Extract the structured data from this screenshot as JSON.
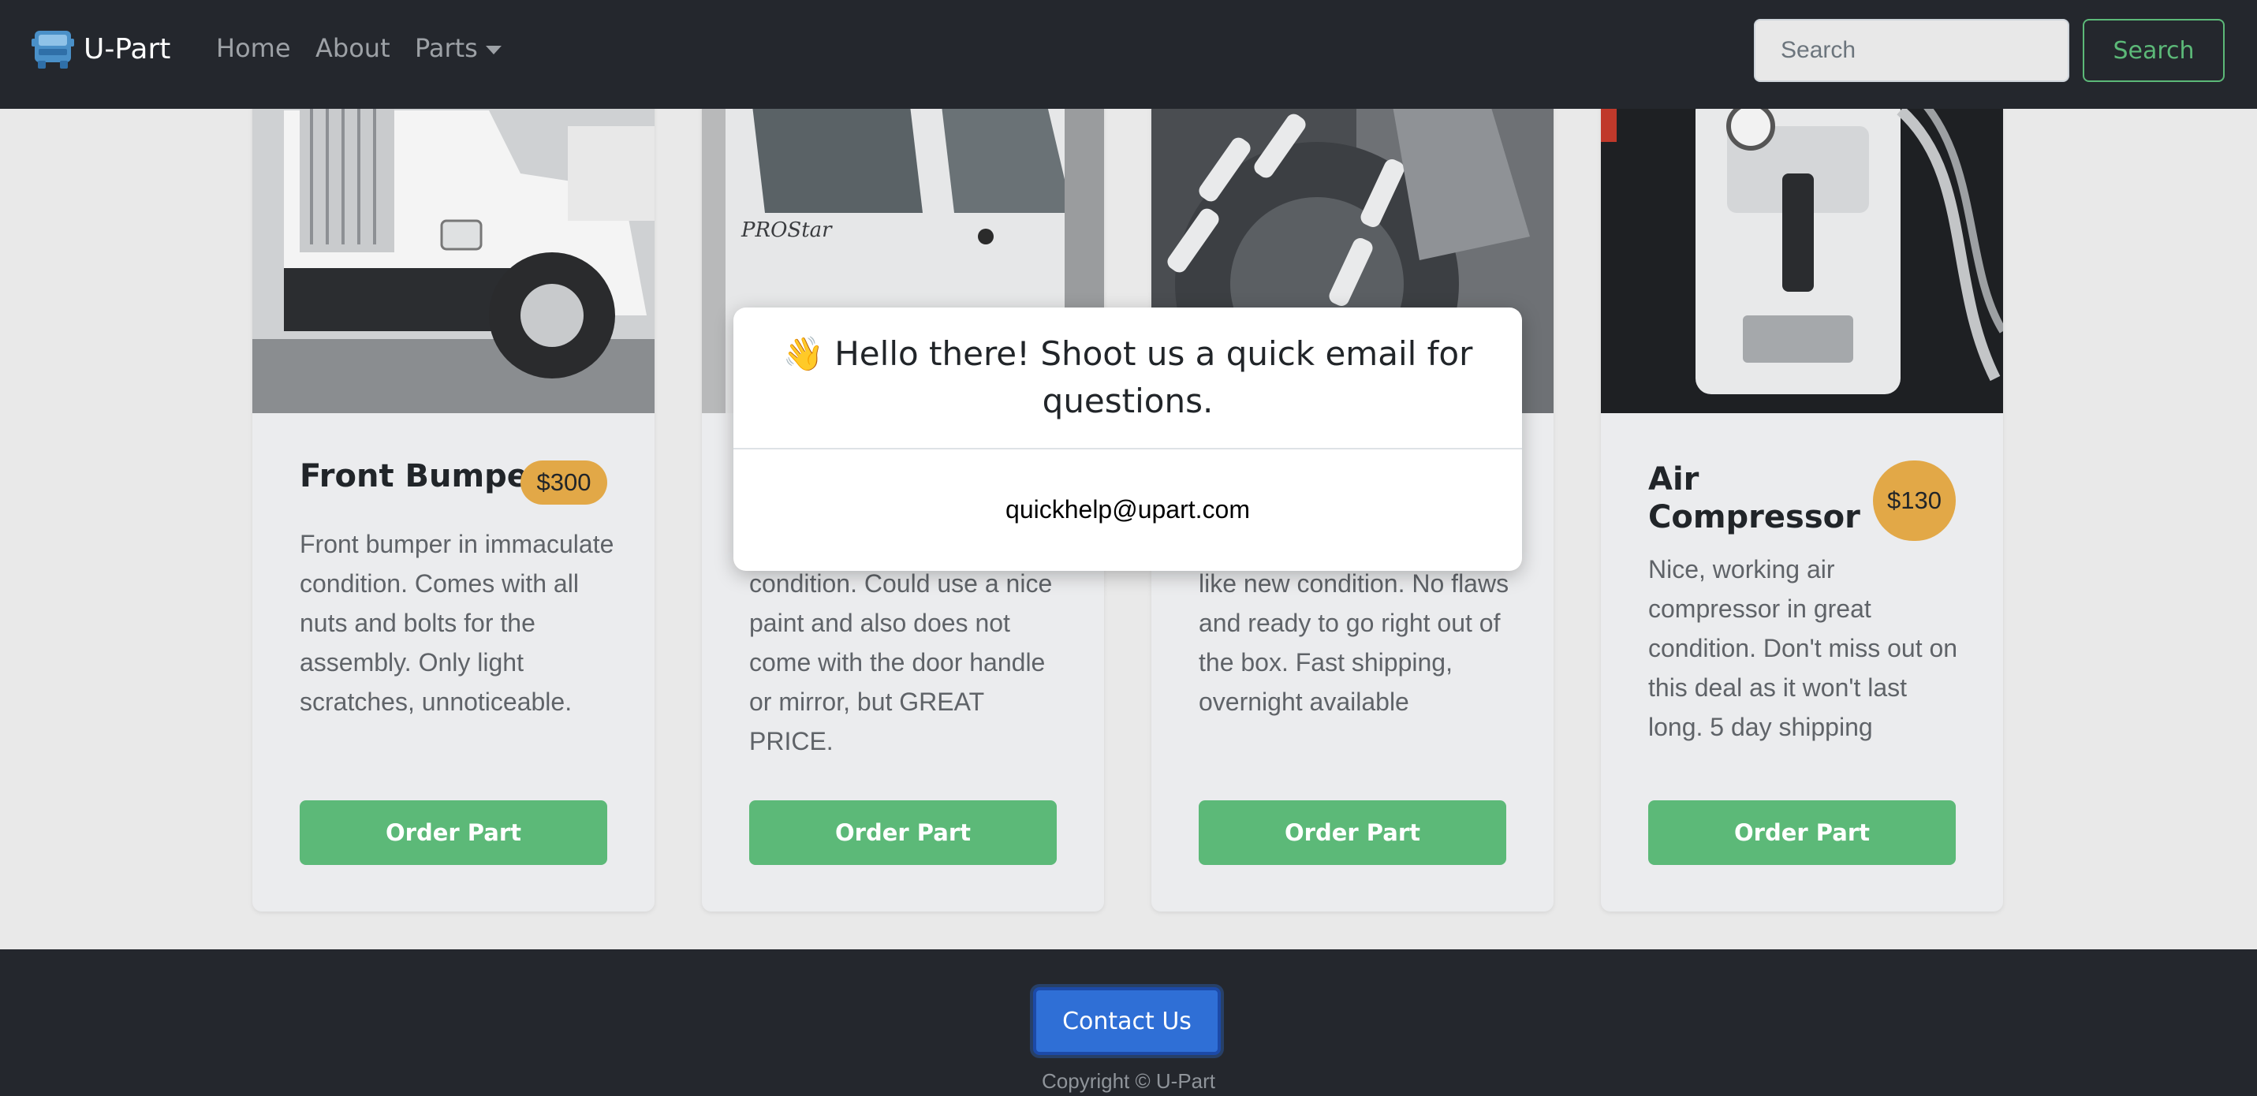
{
  "navbar": {
    "brand": "U-Part",
    "links": {
      "home": "Home",
      "about": "About",
      "parts": "Parts"
    },
    "search_placeholder": "Search",
    "search_button": "Search"
  },
  "cards": [
    {
      "title": "Front Bumper",
      "price": "$300",
      "description": "Front bumper in immaculate condition. Comes with all nuts and bolts for the assembly. Only light scratches, unnoticeable.",
      "button": "Order Part"
    },
    {
      "title": "",
      "price": "",
      "description": "condition. Could use a nice paint and also does not come with the door handle or mirror, but GREAT PRICE.",
      "button": "Order Part"
    },
    {
      "title": "",
      "price": "",
      "description": "like new condition. No flaws and ready to go right out of the box. Fast shipping, overnight available",
      "button": "Order Part"
    },
    {
      "title": "Air Compressor",
      "price": "$130",
      "description": "Nice, working air compressor in great condition. Don't miss out on this deal as it won't last long. 5 day shipping",
      "button": "Order Part"
    }
  ],
  "modal": {
    "title": "👋 Hello there! Shoot us a quick email for questions.",
    "email": "quickhelp@upart.com"
  },
  "footer": {
    "contact_button": "Contact Us",
    "copyright": "Copyright © U-Part"
  },
  "colors": {
    "navbar_bg": "#24272d",
    "accent_green": "#5cb978",
    "price_badge": "#e2a847",
    "contact_blue": "#2f6fd6"
  }
}
